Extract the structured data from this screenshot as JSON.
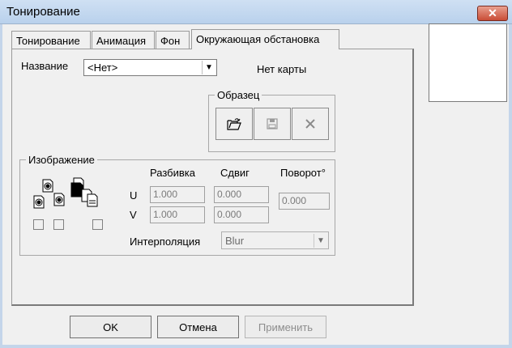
{
  "window": {
    "title": "Тонирование",
    "close_label": "✕"
  },
  "tabs": [
    {
      "label": "Тонирование",
      "active": false
    },
    {
      "label": "Анимация",
      "active": false
    },
    {
      "label": "Фон",
      "active": false
    },
    {
      "label": "Окружающая обстановка",
      "active": true
    }
  ],
  "name_row": {
    "label": "Название",
    "selected": "<Нет>",
    "map_status": "Нет карты"
  },
  "sample": {
    "title": "Образец",
    "buttons": [
      {
        "icon": "open-folder-icon",
        "enabled": true
      },
      {
        "icon": "save-disk-icon",
        "enabled": false
      },
      {
        "icon": "delete-x-icon",
        "enabled": false
      }
    ]
  },
  "image_group": {
    "title": "Изображение",
    "col_headers": {
      "tiling": "Разбивка",
      "offset": "Сдвиг",
      "rotation": "Поворот°"
    },
    "row_u": {
      "label": "U",
      "tiling": "1.000",
      "offset": "0.000"
    },
    "row_v": {
      "label": "V",
      "tiling": "1.000",
      "offset": "0.000"
    },
    "rotation_value": "0.000",
    "interpolation": {
      "label": "Интерполяция",
      "selected": "Blur"
    },
    "checkboxes": [
      false,
      false,
      false
    ]
  },
  "buttons": {
    "ok": "OK",
    "cancel": "Отмена",
    "apply": "Применить"
  }
}
